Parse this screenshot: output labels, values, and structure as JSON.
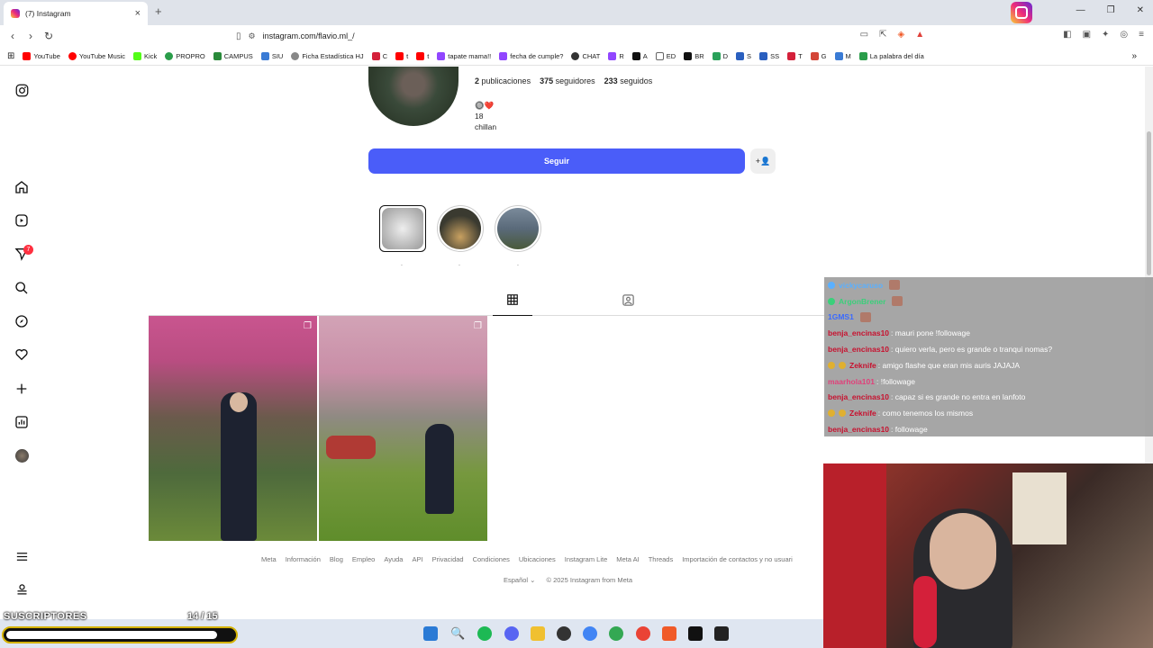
{
  "browser": {
    "tab_title": "(7) Instagram",
    "url": "instagram.com/flavio.ml_/",
    "new_tab": "+",
    "close": "×",
    "window_controls": [
      "—",
      "❐",
      "✕"
    ]
  },
  "bookmarks": [
    {
      "label": "YouTube",
      "color": "#ff0000"
    },
    {
      "label": "YouTube Music",
      "color": "#ff0000"
    },
    {
      "label": "Kick",
      "color": "#53fc18"
    },
    {
      "label": "PROPRO",
      "color": "#2a9d4a"
    },
    {
      "label": "CAMPUS",
      "color": "#2a8a3a"
    },
    {
      "label": "SIU",
      "color": "#3a7bd5"
    },
    {
      "label": "Ficha Estadística HJ",
      "color": "#888888"
    },
    {
      "label": "C",
      "color": "#d4203a"
    },
    {
      "label": "t",
      "color": "#ff0000"
    },
    {
      "label": "t",
      "color": "#ff0000"
    },
    {
      "label": "tapate mama!!",
      "color": "#9146ff"
    },
    {
      "label": "fecha de cumple?",
      "color": "#9146ff"
    },
    {
      "label": "CHAT",
      "color": "#333333"
    },
    {
      "label": "R",
      "color": "#9146ff"
    },
    {
      "label": "A",
      "color": "#111111"
    },
    {
      "label": "ED",
      "color": "#666666"
    },
    {
      "label": "BR",
      "color": "#111111"
    },
    {
      "label": "D",
      "color": "#2aa15a"
    },
    {
      "label": "S",
      "color": "#2a5fbf"
    },
    {
      "label": "SS",
      "color": "#2a5fbf"
    },
    {
      "label": "T",
      "color": "#d4203a"
    },
    {
      "label": "G",
      "color": "#d44638"
    },
    {
      "label": "M",
      "color": "#3a7bd5"
    },
    {
      "label": "La palabra del día",
      "color": "#2a9d4a"
    }
  ],
  "profile": {
    "posts": "2",
    "posts_label": "publicaciones",
    "followers": "375",
    "followers_label": "seguidores",
    "following": "233",
    "following_label": "seguidos",
    "bio_line1": "🔘❤️",
    "bio_line2": "18",
    "bio_line3": "chillan",
    "follow_button": "Seguir",
    "highlights": [
      {
        "label": ".",
        "color": "#c8c8c8"
      },
      {
        "label": ".",
        "color": "#3a3a30"
      },
      {
        "label": ".",
        "color": "#5a6a7a"
      }
    ]
  },
  "nav": {
    "notifications_badge": "7"
  },
  "footer": {
    "links": [
      "Meta",
      "Información",
      "Blog",
      "Empleo",
      "Ayuda",
      "API",
      "Privacidad",
      "Condiciones",
      "Ubicaciones",
      "Instagram Lite",
      "Meta AI",
      "Threads",
      "Importación de contactos y no usuari"
    ],
    "language": "Español ⌄",
    "copyright": "© 2025 Instagram from Meta"
  },
  "chat": [
    {
      "user": "vickycaruso",
      "msg": "",
      "color": "#5ab0ff"
    },
    {
      "user": "ArgonBrener",
      "msg": "",
      "color": "#3ad07a"
    },
    {
      "user": "1GMS1",
      "msg": "",
      "color": "#3a6aff"
    },
    {
      "user": "benja_encinas10",
      "msg": ": mauri pone !followage",
      "color": "#c8102e"
    },
    {
      "user": "benja_encinas10",
      "msg": ": quiero verla, pero es grande o tranqui nomas?",
      "color": "#c8102e"
    },
    {
      "user": "Zeknife",
      "msg": ": amigo flashe que eran mis auris JAJAJA",
      "color": "#c8102e"
    },
    {
      "user": "maarhola101",
      "msg": ": !followage",
      "color": "#e0407a"
    },
    {
      "user": "benja_encinas10",
      "msg": ": capaz si es grande no entra en lanfoto",
      "color": "#c8102e"
    },
    {
      "user": "Zeknife",
      "msg": ": como tenemos los mismos",
      "color": "#c8102e"
    },
    {
      "user": "benja_encinas10",
      "msg": ": followage",
      "color": "#c8102e"
    }
  ],
  "stream": {
    "sub_label": "SUSCRIPTORES",
    "sub_count": "14 / 15",
    "sub_progress": 0.93
  }
}
